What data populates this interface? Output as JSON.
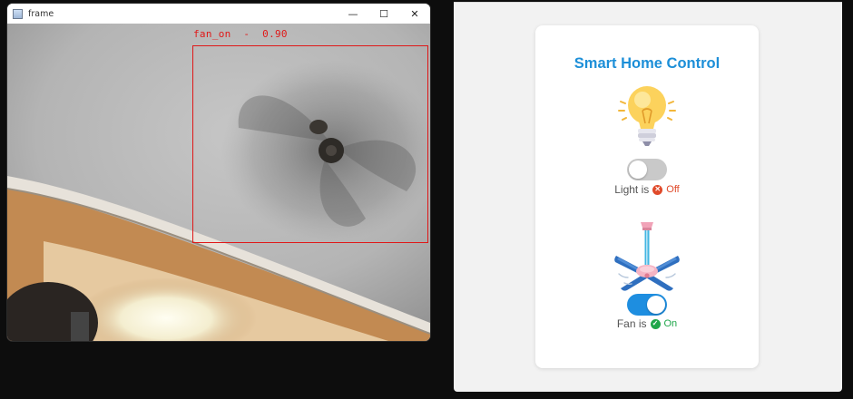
{
  "cv_window": {
    "title": "frame",
    "controls": {
      "minimize": "—",
      "maximize": "☐",
      "close": "✕"
    },
    "detection": {
      "label": "fan_on  -  0.90"
    }
  },
  "smart_home": {
    "title": "Smart Home Control",
    "light": {
      "prefix": "Light is",
      "state": "Off",
      "toggle_on": false,
      "icon": "lightbulb-icon",
      "status_icon": "x-circle-icon",
      "status_color": "#e04a2a"
    },
    "fan": {
      "prefix": "Fan is",
      "state": "On",
      "toggle_on": true,
      "icon": "ceiling-fan-icon",
      "status_icon": "check-circle-icon",
      "status_color": "#1fa64a"
    },
    "colors": {
      "accent": "#1d8fd8",
      "toggle_on": "#1e8ee0",
      "toggle_off": "#c9c9c9"
    }
  }
}
